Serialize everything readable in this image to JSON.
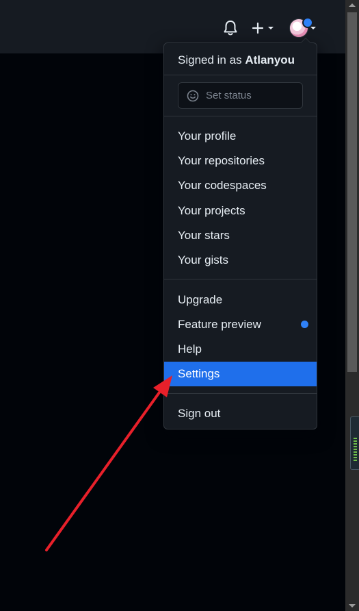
{
  "header": {
    "icons": [
      "bell-icon",
      "plus-icon",
      "chevron-down-icon",
      "avatar"
    ]
  },
  "menu": {
    "signed_in_prefix": "Signed in as",
    "username": "Atlanyou",
    "set_status_label": "Set status",
    "items": [
      {
        "label": "Your profile"
      },
      {
        "label": "Your repositories"
      },
      {
        "label": "Your codespaces"
      },
      {
        "label": "Your projects"
      },
      {
        "label": "Your stars"
      },
      {
        "label": "Your gists"
      },
      {
        "label": "Upgrade"
      },
      {
        "label": "Feature preview"
      },
      {
        "label": "Help"
      },
      {
        "label": "Settings"
      },
      {
        "label": "Sign out"
      }
    ],
    "highlighted_item": "Settings"
  },
  "colors": {
    "background": "#010409",
    "header": "#161b22",
    "menu_bg": "#161b22",
    "border": "#30363d",
    "text": "#e6edf3",
    "accent": "#1f6feb",
    "notification_dot": "#2f81f7",
    "annotation_arrow": "#e8202a"
  }
}
